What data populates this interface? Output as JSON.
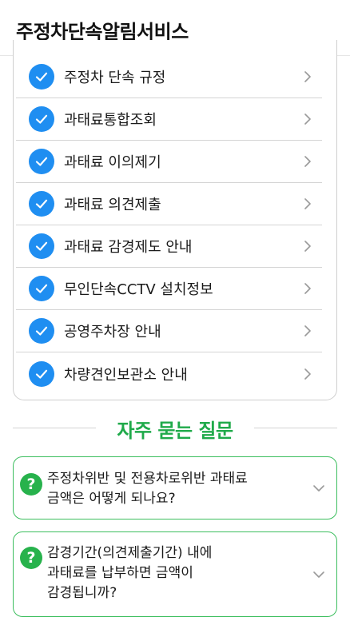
{
  "header": {
    "title": "주정차단속알림서비스"
  },
  "menu": {
    "items": [
      {
        "label": "주정차 단속 규정"
      },
      {
        "label": "과태료통합조회"
      },
      {
        "label": "과태료 이의제기"
      },
      {
        "label": "과태료 의견제출"
      },
      {
        "label": "과태료 감경제도 안내"
      },
      {
        "label": "무인단속CCTV 설치정보"
      },
      {
        "label": "공영주차장 안내"
      },
      {
        "label": "차량견인보관소 안내"
      }
    ]
  },
  "faq": {
    "heading": "자주 묻는 질문",
    "icon_glyph": "?",
    "items": [
      {
        "question": "주정차위반 및 전용차로위반 과태료\n금액은 어떻게 되나요?"
      },
      {
        "question": "감경기간(의견제출기간) 내에\n과태료를 납부하면 금액이\n감경됩니까?"
      }
    ]
  },
  "colors": {
    "check_blue": "#1f8ef1",
    "faq_green": "#1faa4a",
    "faq_border": "#3cbe5e"
  }
}
